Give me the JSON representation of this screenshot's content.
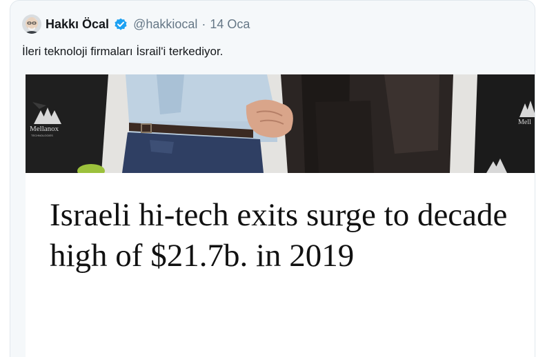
{
  "tweet": {
    "author": {
      "display_name": "Hakkı Öcal",
      "handle": "@hakkiocal",
      "verified": true
    },
    "separator": "·",
    "timestamp": "14 Oca",
    "text": "İleri teknoloji firmaları İsrail'i terkediyor."
  },
  "card": {
    "title": "Israeli hi-tech exits surge to decade high of $21.7b. in 2019",
    "image": {
      "banner_left_text": "Mellanox",
      "banner_left_subtext": "TECHNOLOGIES",
      "banner_right_text": "Mell"
    }
  },
  "colors": {
    "verified_badge": "#1da1f2",
    "secondary_text": "#657786",
    "primary_text": "#14171a",
    "tweet_background": "#f5f8fa"
  }
}
